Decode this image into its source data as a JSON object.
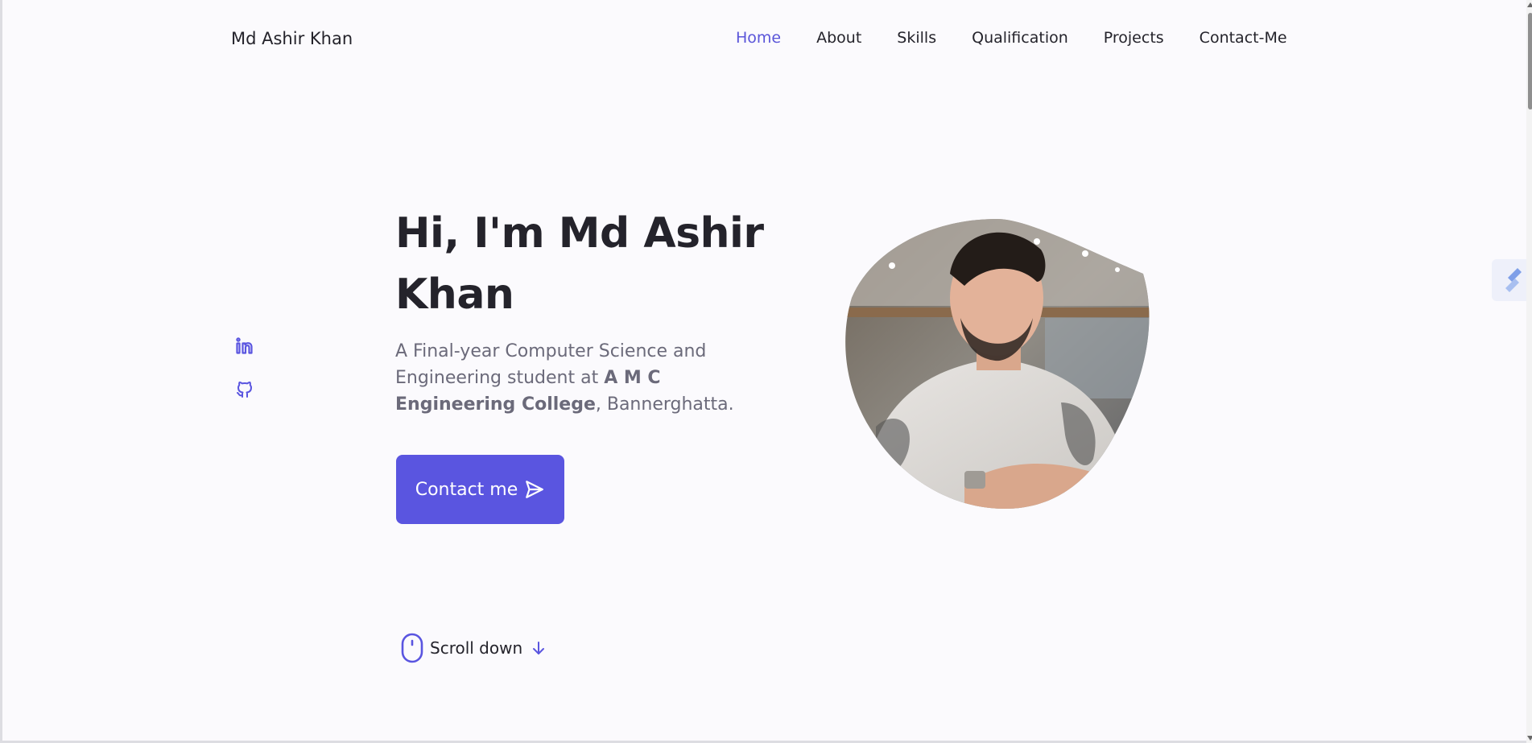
{
  "header": {
    "logo": "Md Ashir Khan",
    "nav": [
      {
        "label": "Home",
        "active": true
      },
      {
        "label": "About",
        "active": false
      },
      {
        "label": "Skills",
        "active": false
      },
      {
        "label": "Qualification",
        "active": false
      },
      {
        "label": "Projects",
        "active": false
      },
      {
        "label": "Contact-Me",
        "active": false
      }
    ]
  },
  "social": {
    "icons": [
      "linkedin-icon",
      "github-icon"
    ]
  },
  "hero": {
    "title": "Hi, I'm Md Ashir Khan",
    "desc_part1": "A Final-year Computer Science and Engineering student at ",
    "desc_bold": "A M C Engineering College",
    "desc_part2": ", Bannerghatta.",
    "button_label": "Contact me",
    "button_icon": "send-icon",
    "image": "profile-photo"
  },
  "scroll": {
    "label": "Scroll down",
    "icons": [
      "mouse-icon",
      "arrow-down-icon"
    ]
  },
  "colors": {
    "accent": "#5a55e0",
    "background": "#fbfafd",
    "text": "#24232b",
    "muted": "#6b6a7a"
  }
}
